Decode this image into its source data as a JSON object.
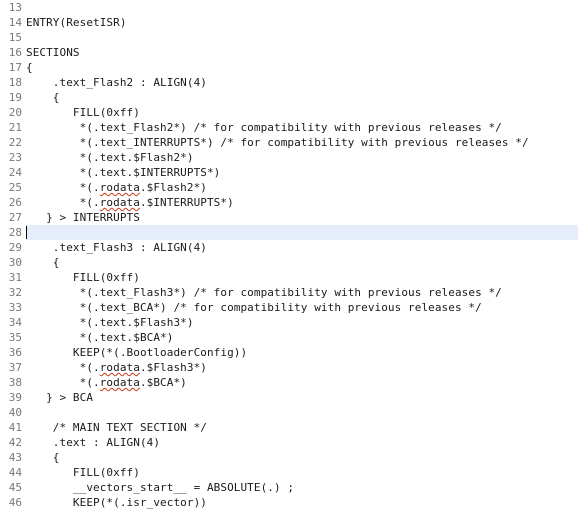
{
  "editor": {
    "first_line_number": 13,
    "current_line_number": 28,
    "caret_column": 0,
    "highlight_color": "#e5edfa",
    "text_color": "#1a1a1a",
    "gutter_color": "#787878",
    "spellcheck_underline_color": "#cc3b18",
    "background": "#ffffff",
    "lines": [
      {
        "num": "13",
        "text": ""
      },
      {
        "num": "14",
        "text": "ENTRY(ResetISR)"
      },
      {
        "num": "15",
        "text": ""
      },
      {
        "num": "16",
        "text": "SECTIONS"
      },
      {
        "num": "17",
        "text": "{"
      },
      {
        "num": "18",
        "text": "    .text_Flash2 : ALIGN(4)"
      },
      {
        "num": "19",
        "text": "    {"
      },
      {
        "num": "20",
        "text": "       FILL(0xff)"
      },
      {
        "num": "21",
        "text": "        *(.text_Flash2*) /* for compatibility with previous releases */"
      },
      {
        "num": "22",
        "text": "        *(.text_INTERRUPTS*) /* for compatibility with previous releases */"
      },
      {
        "num": "23",
        "text": "        *(.text.$Flash2*)"
      },
      {
        "num": "24",
        "text": "        *(.text.$INTERRUPTS*)"
      },
      {
        "num": "25",
        "text": "        *(.rodata.$Flash2*)",
        "squiggles": [
          "rodata"
        ]
      },
      {
        "num": "26",
        "text": "        *(.rodata.$INTERRUPTS*)",
        "squiggles": [
          "rodata"
        ]
      },
      {
        "num": "27",
        "text": "   } > INTERRUPTS"
      },
      {
        "num": "28",
        "text": "",
        "current": true
      },
      {
        "num": "29",
        "text": "    .text_Flash3 : ALIGN(4)"
      },
      {
        "num": "30",
        "text": "    {"
      },
      {
        "num": "31",
        "text": "       FILL(0xff)"
      },
      {
        "num": "32",
        "text": "        *(.text_Flash3*) /* for compatibility with previous releases */"
      },
      {
        "num": "33",
        "text": "        *(.text_BCA*) /* for compatibility with previous releases */"
      },
      {
        "num": "34",
        "text": "        *(.text.$Flash3*)"
      },
      {
        "num": "35",
        "text": "        *(.text.$BCA*)"
      },
      {
        "num": "36",
        "text": "       KEEP(*(.BootloaderConfig))"
      },
      {
        "num": "37",
        "text": "        *(.rodata.$Flash3*)",
        "squiggles": [
          "rodata"
        ]
      },
      {
        "num": "38",
        "text": "        *(.rodata.$BCA*)",
        "squiggles": [
          "rodata"
        ]
      },
      {
        "num": "39",
        "text": "   } > BCA"
      },
      {
        "num": "40",
        "text": ""
      },
      {
        "num": "41",
        "text": "    /* MAIN TEXT SECTION */"
      },
      {
        "num": "42",
        "text": "    .text : ALIGN(4)"
      },
      {
        "num": "43",
        "text": "    {"
      },
      {
        "num": "44",
        "text": "       FILL(0xff)"
      },
      {
        "num": "45",
        "text": "       __vectors_start__ = ABSOLUTE(.) ;"
      },
      {
        "num": "46",
        "text": "       KEEP(*(.isr_vector))"
      }
    ]
  }
}
